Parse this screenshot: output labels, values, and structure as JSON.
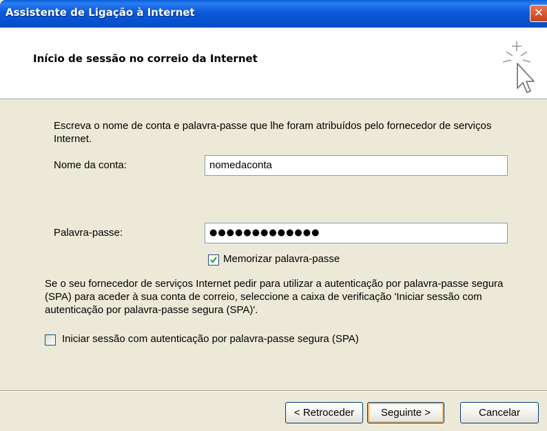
{
  "window": {
    "title": "Assistente de Ligação à Internet",
    "close_label": "✕"
  },
  "header": {
    "title": "Início de sessão no correio da Internet",
    "icon": "wizard-cursor-icon"
  },
  "form": {
    "intro": "Escreva o nome de conta e palavra-passe que lhe foram atribuídos pelo fornecedor de serviços Internet.",
    "account_label": "Nome da conta:",
    "account_value": "nomedaconta",
    "password_label": "Palavra-passe:",
    "password_value": "●●●●●●●●●●●●●",
    "remember_label": "Memorizar palavra-passe",
    "remember_checked": true,
    "spa_text": "Se o seu fornecedor de serviços Internet pedir para utilizar a autenticação por palavra-passe segura (SPA) para aceder à sua conta de correio, seleccione a caixa de verificação 'Iniciar sessão com autenticação por palavra-passe segura (SPA)'.",
    "spa_label": "Iniciar sessão com autenticação por palavra-passe segura (SPA)",
    "spa_checked": false
  },
  "buttons": {
    "back": "< Retroceder",
    "next": "Seguinte >",
    "cancel": "Cancelar"
  },
  "colors": {
    "titlebar": "#0b58d8",
    "dialog_bg": "#ece9d8",
    "close_button": "#d2542f",
    "checkmark": "#21a121"
  }
}
